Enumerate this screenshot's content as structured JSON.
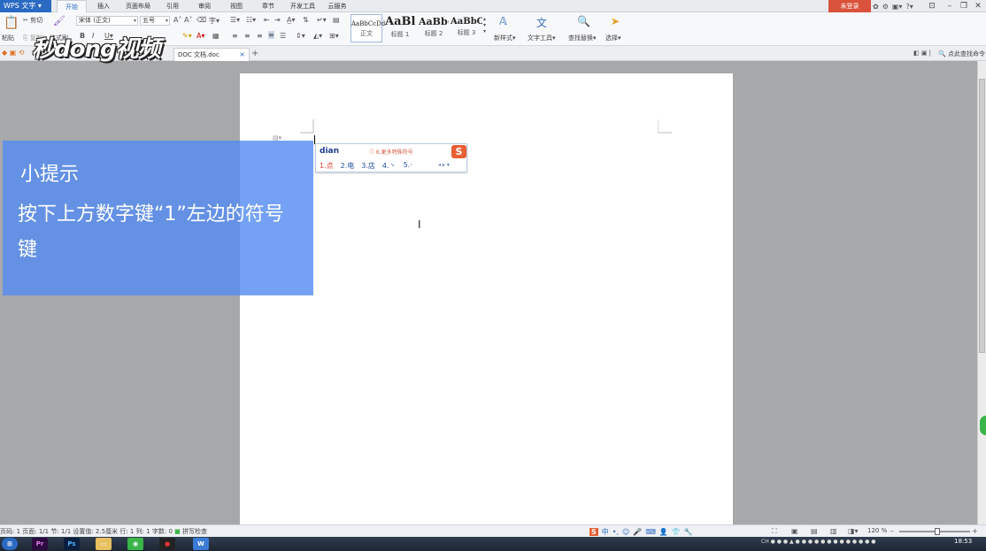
{
  "app": {
    "wps_button": "WPS 文字",
    "menu_tabs": [
      "开始",
      "插入",
      "页面布局",
      "引用",
      "审阅",
      "视图",
      "章节",
      "开发工具",
      "云服务"
    ],
    "login": "未登录"
  },
  "ribbon": {
    "paste": "粘贴",
    "cut": "剪切",
    "copy": "复制",
    "format_painter": "格式刷",
    "font_name": "宋体 (正文)",
    "font_size": "五号",
    "styles": [
      {
        "sample": "AaBbCcDd",
        "name": "正文"
      },
      {
        "sample": "AaBl",
        "name": "标题 1"
      },
      {
        "sample": "AaBb(",
        "name": "标题 2"
      },
      {
        "sample": "AaBbC",
        "name": "标题 3"
      }
    ],
    "new_style": "新样式",
    "text_tools": "文字工具",
    "find_replace": "查找替换",
    "select": "选择"
  },
  "tabbar": {
    "doc_tab": "DOC 文档.doc",
    "search_cmd": "点此查找命令"
  },
  "ime": {
    "pinyin": "dian",
    "hint": "6.更多特殊符号",
    "candidates": [
      "1.点",
      "2.电",
      "3.店",
      "4.丶",
      "5.·"
    ]
  },
  "tip": {
    "title": "小提示",
    "body": "按下上方数字键“1”左边的符号键"
  },
  "watermark": "秒dong视频",
  "statusbar": {
    "page_info": "页码: 1   页面: 1/1   节: 1/1   设置值: 2.5厘米   行: 1   列: 1   字数: 0",
    "spell_check": "拼写检查",
    "zoom": "120 %"
  },
  "taskbar": {
    "time": "18:53"
  }
}
